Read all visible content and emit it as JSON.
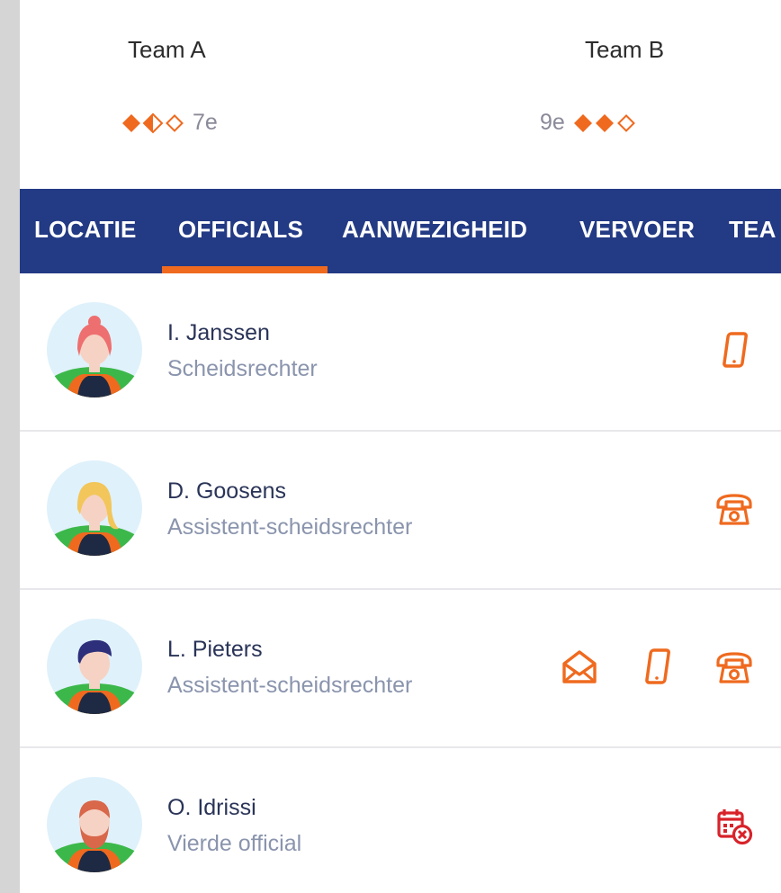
{
  "match": {
    "team_a": {
      "name": "Team A",
      "rank": "7e",
      "form": [
        "full",
        "half",
        "empty"
      ]
    },
    "team_b": {
      "name": "Team B",
      "rank": "9e",
      "form": [
        "full",
        "full",
        "empty"
      ]
    }
  },
  "tabs": [
    {
      "label": "LOCATIE",
      "active": false
    },
    {
      "label": "OFFICIALS",
      "active": true
    },
    {
      "label": "AANWEZIGHEID",
      "active": false
    },
    {
      "label": "VERVOER",
      "active": false
    },
    {
      "label": "TEA",
      "active": false
    }
  ],
  "officials": [
    {
      "name": "I. Janssen",
      "role": "Scheidsrechter",
      "avatar": "avatar-woman-red-hair",
      "contacts": [
        "mobile-phone-icon"
      ]
    },
    {
      "name": "D. Goosens",
      "role": "Assistent-scheidsrechter",
      "avatar": "avatar-woman-blonde-hair",
      "contacts": [
        "landline-phone-icon"
      ]
    },
    {
      "name": "L. Pieters",
      "role": "Assistent-scheidsrechter",
      "avatar": "avatar-man-dark-hair",
      "contacts": [
        "email-icon",
        "mobile-phone-icon",
        "landline-phone-icon"
      ]
    },
    {
      "name": "O. Idrissi",
      "role": "Vierde official",
      "avatar": "avatar-man-beard",
      "contacts": [
        "calendar-unavailable-icon"
      ]
    }
  ],
  "colors": {
    "accent": "#ef6a1f",
    "nav_bg": "#233a84",
    "unavailable": "#d8232a"
  }
}
